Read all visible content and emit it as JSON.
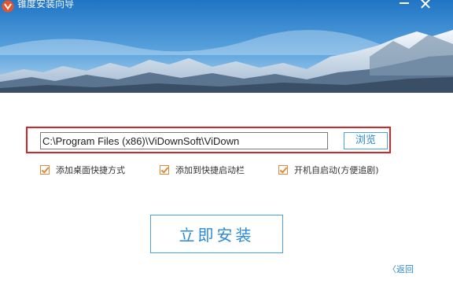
{
  "window": {
    "title": "锥度安装向导",
    "minimize_icon": "minimize-icon",
    "close_icon": "close-icon",
    "close_glyph": "✕"
  },
  "install": {
    "path_value": "C:\\Program Files (x86)\\ViDownSoft\\ViDown",
    "browse_label": "浏览",
    "options": [
      {
        "label": "添加桌面快捷方式",
        "checked": true
      },
      {
        "label": "添加到快捷启动栏",
        "checked": true
      },
      {
        "label": "开机自启动(方便追剧)",
        "checked": true
      }
    ],
    "install_label": "立即安装",
    "back_label": "〈返回"
  },
  "colors": {
    "accent": "#2b8ad6",
    "highlight_border": "#d42626",
    "checkbox": "#e08a3c"
  }
}
